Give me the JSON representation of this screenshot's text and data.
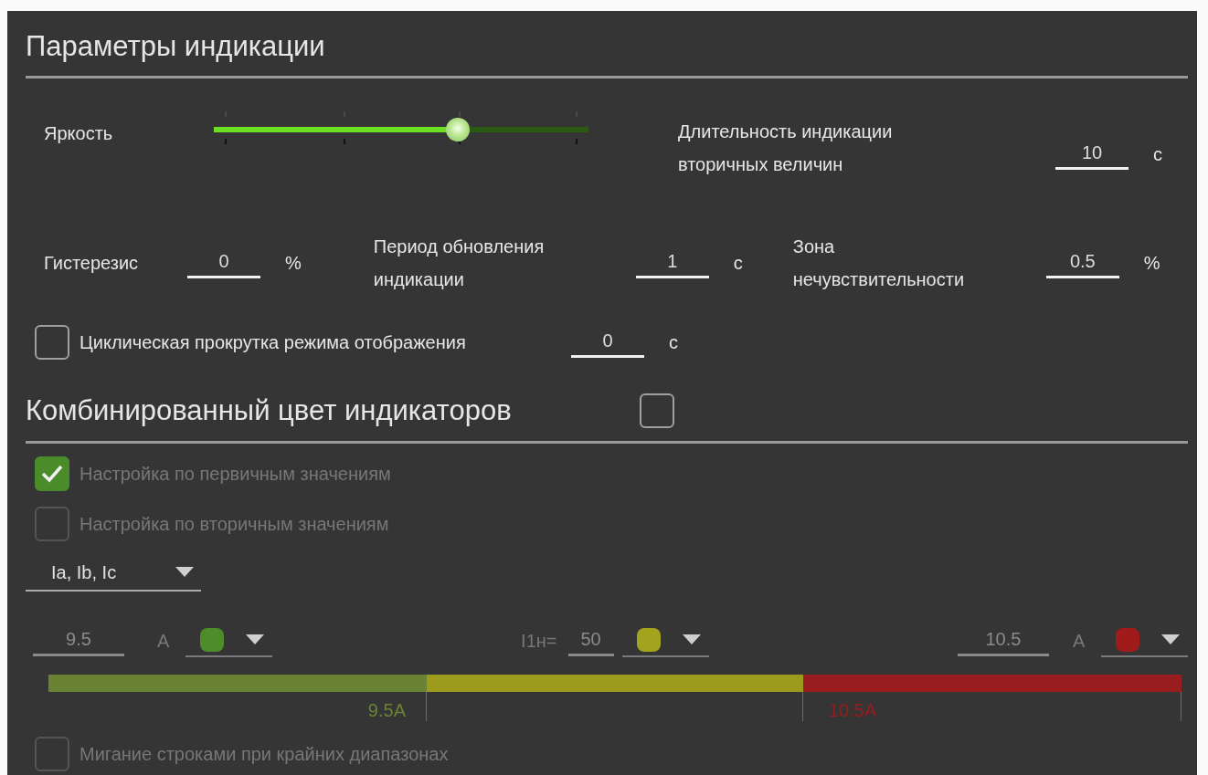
{
  "display": {
    "title": "Параметры индикации",
    "brightness": {
      "label": "Яркость",
      "level": 0.65
    },
    "secondary_duration": {
      "label": "Длительность индикации вторичных величин",
      "value": "10",
      "unit": "с"
    },
    "fields": [
      {
        "label": "Гистерезис",
        "value": "0",
        "unit": "%"
      },
      {
        "label": "Период обновления индикации",
        "value": "1",
        "unit": "с"
      },
      {
        "label": "Зона нечувствительности",
        "value": "0.5",
        "unit": "%"
      }
    ],
    "cyclic_scroll": {
      "label": "Циклическая прокрутка режима отображения",
      "checked": false,
      "value": "0",
      "unit": "с"
    }
  },
  "combined": {
    "title": "Комбинированный цвет индикаторов",
    "checked": false,
    "disabled": true,
    "options": [
      {
        "label": "Настройка по первичным значениям",
        "checked": true
      },
      {
        "label": "Настройка по вторичным  значениям",
        "checked": false
      }
    ],
    "dropdown": {
      "value": "Ia, Ib, Ic"
    },
    "low": {
      "value": "9.5",
      "unit": "A",
      "color": "#4e8c2a"
    },
    "nominal": {
      "label": "I1н=",
      "value": "50",
      "color": "#a3a41e"
    },
    "high": {
      "value": "10.5",
      "unit": "A",
      "color": "#a01b1b"
    },
    "scale": [
      {
        "color": "#6a8234",
        "label": "9.5A"
      },
      {
        "color": "#9c9b1e"
      },
      {
        "color": "#991c1e",
        "label": "10.5A"
      }
    ],
    "blink": {
      "label": "Мигание строками при крайних диапазонах",
      "checked": false
    }
  }
}
